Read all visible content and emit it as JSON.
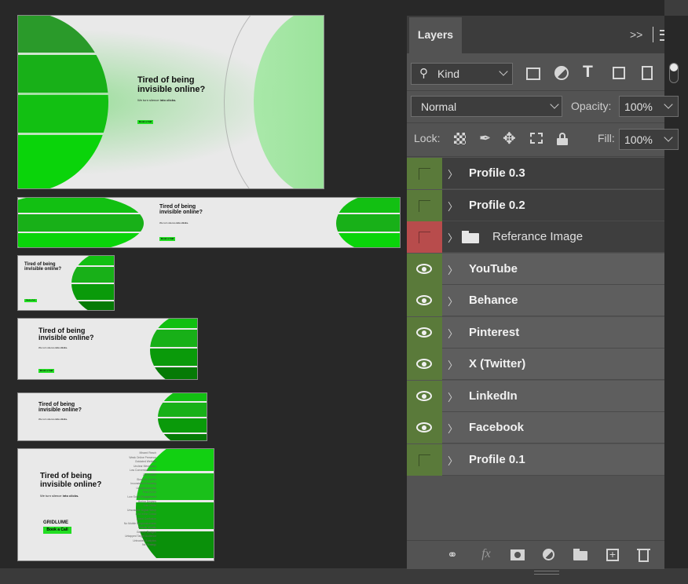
{
  "canvas": {
    "headline_line1": "Tired of being",
    "headline_line2": "invisible online?",
    "subline_prefix": "We turn silence ",
    "subline_bold": "into clicks.",
    "brand": "GRIDLUME",
    "cta": "Book a Call",
    "keywords": [
      "Missed Reach",
      "Weak Online Presence",
      "Outdated Website",
      "Unclear Messaging",
      "Low Conversion Rates",
      "Zero Leads",
      "Slow Site Speed",
      "Inconsistent Branding",
      "Unoptimized Ads",
      "Poor UX/UI",
      "Low Social Engagement",
      "Boring Designs",
      "Low Clicks",
      "Unscalable Digital Setup",
      "Lost in the Crowd",
      "Brand Confusion",
      "No Mobile Responsiveness",
      "Chaotic Visuals",
      "Generic Designs",
      "Untapped Target Audience",
      "Unhooked Analytics",
      "No Strategy"
    ]
  },
  "panel": {
    "tab_title": "Layers",
    "expand_icon": ">>",
    "filter": {
      "kind_label": "Kind"
    },
    "blend_mode": "Normal",
    "opacity_label": "Opacity:",
    "opacity_value": "100%",
    "lock_label": "Lock:",
    "fill_label": "Fill:",
    "fill_value": "100%",
    "layers": [
      {
        "name": "Profile 0.3",
        "visible": false,
        "type": "group",
        "tag_color": "#5a7a3a"
      },
      {
        "name": "Profile 0.2",
        "visible": false,
        "type": "group",
        "tag_color": "#5a7a3a"
      },
      {
        "name": "Referance Image",
        "visible": false,
        "type": "folder",
        "tag_color": "#b84c4c"
      },
      {
        "name": "YouTube",
        "visible": true,
        "type": "group",
        "tag_color": "#5a7a3a"
      },
      {
        "name": "Behance",
        "visible": true,
        "type": "group",
        "tag_color": "#5a7a3a"
      },
      {
        "name": "Pinterest",
        "visible": true,
        "type": "group",
        "tag_color": "#5a7a3a"
      },
      {
        "name": "X (Twitter)",
        "visible": true,
        "type": "group",
        "tag_color": "#5a7a3a"
      },
      {
        "name": "LinkedIn",
        "visible": true,
        "type": "group",
        "tag_color": "#5a7a3a"
      },
      {
        "name": "Facebook",
        "visible": true,
        "type": "group",
        "tag_color": "#5a7a3a"
      },
      {
        "name": "Profile 0.1",
        "visible": false,
        "type": "group",
        "tag_color": "#5a7a3a"
      }
    ],
    "footer_icons": [
      "link-icon",
      "fx-icon",
      "mask-icon",
      "adjustment-icon",
      "folder-icon",
      "new-layer-icon",
      "trash-icon"
    ]
  }
}
